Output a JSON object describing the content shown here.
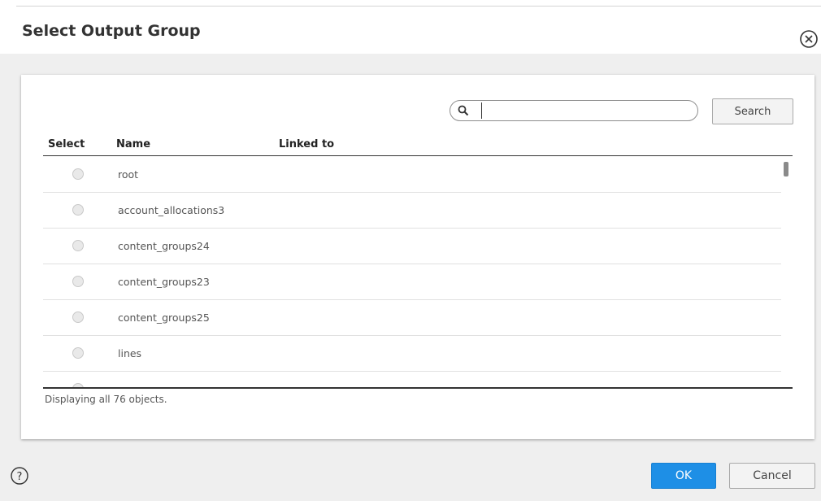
{
  "dialog": {
    "title": "Select Output Group"
  },
  "search": {
    "placeholder": "",
    "value": "",
    "button_label": "Search"
  },
  "table": {
    "columns": [
      "Select",
      "Name",
      "Linked to"
    ],
    "rows": [
      {
        "name": "root",
        "linked_to": ""
      },
      {
        "name": "account_allocations3",
        "linked_to": ""
      },
      {
        "name": "content_groups24",
        "linked_to": ""
      },
      {
        "name": "content_groups23",
        "linked_to": ""
      },
      {
        "name": "content_groups25",
        "linked_to": ""
      },
      {
        "name": "lines",
        "linked_to": ""
      },
      {
        "name": "__partial_row__",
        "linked_to": ""
      }
    ]
  },
  "status": {
    "text": "Displaying all 76 objects."
  },
  "footer": {
    "ok_label": "OK",
    "cancel_label": "Cancel"
  },
  "colors": {
    "primary": "#1e8fe6",
    "panel_bg": "#efefef"
  },
  "icons": {
    "close": "close-circle-icon",
    "search": "search-icon",
    "help": "help-circle-icon"
  }
}
